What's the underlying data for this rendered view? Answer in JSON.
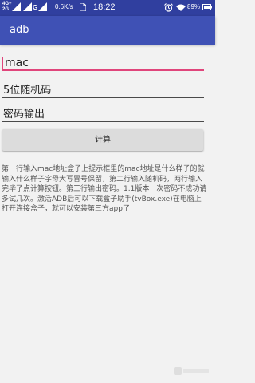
{
  "status_bar": {
    "network_top": "4G+",
    "network_bottom": "2G",
    "g_label": "G",
    "speed": "0.6K/s",
    "time": "18:22",
    "battery": "89%"
  },
  "app": {
    "title": "adb"
  },
  "form": {
    "mac_value": "mac",
    "code_value": "5位随机码",
    "password_value": "密码输出",
    "calculate_label": "计算"
  },
  "info": {
    "text": "第一行输入mac地址盒子上提示框里的mac地址是什么样子的就输入什么样子字母大写冒号保留，第二行输入随机码，两行输入完毕了点计算按钮。第三行输出密码。1.1版本一次密码不成功请多试几次。激活ADB后可以下载盒子助手(tvBox.exe)在电脑上打开连接盒子，就可以安装第三方app了"
  },
  "colors": {
    "status_bar": "#303f9f",
    "app_bar": "#3f51b5",
    "accent": "#e0457b",
    "background": "#f2f2f2",
    "button": "#dcdcdc"
  },
  "icons": [
    "signal-icon",
    "file-icon",
    "alarm-icon",
    "wifi-icon",
    "battery-icon",
    "watermark-logo"
  ]
}
